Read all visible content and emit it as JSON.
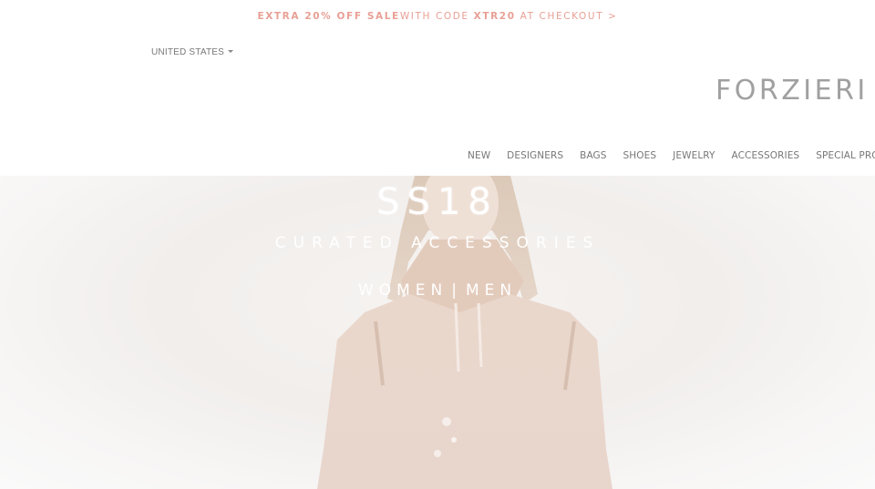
{
  "promo": {
    "bold_prefix": "EXTRA 20% OFF SALE",
    "mid_text": "WITH CODE",
    "code": "XTR20",
    "suffix": "AT CHECKOUT >"
  },
  "header": {
    "country": "UNITED STATES",
    "logo": "FORZIERI"
  },
  "nav": {
    "items": [
      "NEW",
      "DESIGNERS",
      "BAGS",
      "SHOES",
      "JEWELRY",
      "ACCESSORIES",
      "SPECIAL PROJECTS"
    ]
  },
  "hero": {
    "season": "SS18",
    "subtitle": "CURATED ACCESSORIES",
    "link_women": "WOMEN",
    "separator": "|",
    "link_men": "MEN"
  },
  "colors": {
    "promo_text": "#e8a095",
    "logo": "#a0a0a0",
    "nav_text": "#777777",
    "hero_text": "#ffffff"
  }
}
